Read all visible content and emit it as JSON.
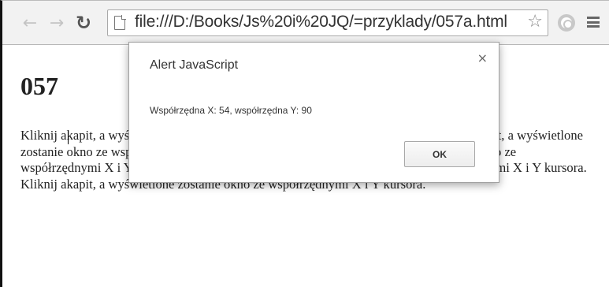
{
  "browser": {
    "url": "file:///D:/Books/Js%20i%20JQ/=przyklady/057a.html",
    "icons": {
      "back": "back-arrow-icon",
      "forward": "forward-arrow-icon",
      "reload": "reload-icon",
      "page": "page-icon",
      "bookmark": "star-icon",
      "extension": "extension-icon",
      "menu": "hamburger-menu-icon"
    }
  },
  "page": {
    "title": "057",
    "paragraph": "Kliknij akapit, a wyświetlone zostanie okno ze współrzędnymi X i Y kursora. Kliknij akapit, a wyświetlone zostanie okno ze współrzędnymi X i Y kursora. Kliknij akapit, a wyświetlone zostanie okno ze współrzędnymi X i Y kursora. Kliknij akapit, a wyświetlone zostanie okno ze współrzędnymi X i Y kursora. Kliknij akapit, a wyświetlone zostanie okno ze współrzędnymi X i Y kursora."
  },
  "alert": {
    "title": "Alert JavaScript",
    "close": "×",
    "message": "Współrzędna X: 54, współrzędna Y: 90",
    "ok_label": "OK"
  }
}
